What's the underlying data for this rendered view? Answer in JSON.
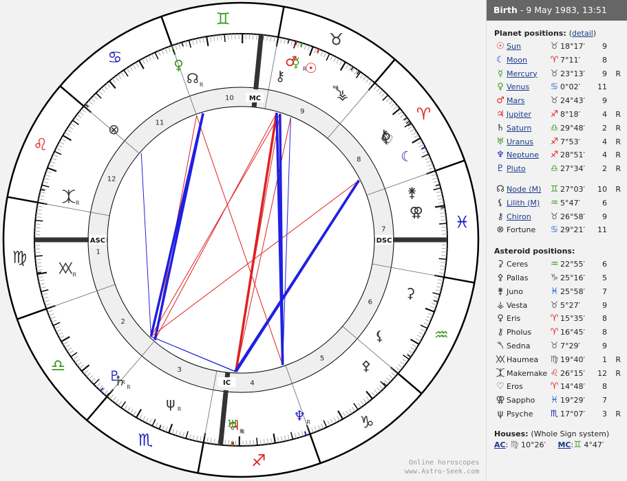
{
  "header": {
    "event": "Birth",
    "datetime": " - 9 May 1983, 13:51"
  },
  "planet_section": {
    "title": "Planet positions:",
    "detail_link": "detail"
  },
  "planets": [
    {
      "name": "Sun",
      "icon": "sun-icon",
      "glyph": "☉",
      "color": "#e02020",
      "sign": "Taurus",
      "sign_glyph": "♉",
      "sign_color": "#666666",
      "degree": "18°17′",
      "house": "9",
      "retro": "",
      "lon": 48.28
    },
    {
      "name": "Moon",
      "icon": "moon-icon",
      "glyph": "☾",
      "color": "#2020c0",
      "sign": "Aries",
      "sign_glyph": "♈",
      "sign_color": "#e02020",
      "degree": "7°11′",
      "house": "8",
      "retro": "",
      "lon": 7.18
    },
    {
      "name": "Mercury",
      "icon": "mercury-icon",
      "glyph": "☿",
      "color": "#3a9a20",
      "sign": "Taurus",
      "sign_glyph": "♉",
      "sign_color": "#666666",
      "degree": "23°13′",
      "house": "9",
      "retro": "R",
      "lon": 53.22
    },
    {
      "name": "Venus",
      "icon": "venus-icon",
      "glyph": "♀",
      "color": "#3a9a20",
      "sign": "Cancer",
      "sign_glyph": "♋",
      "sign_color": "#3a70d0",
      "degree": "0°02′",
      "house": "11",
      "retro": "",
      "lon": 90.03
    },
    {
      "name": "Mars",
      "icon": "mars-icon",
      "glyph": "♂",
      "color": "#e02020",
      "sign": "Taurus",
      "sign_glyph": "♉",
      "sign_color": "#666666",
      "degree": "24°43′",
      "house": "9",
      "retro": "",
      "lon": 54.72
    },
    {
      "name": "Jupiter",
      "icon": "jupiter-icon",
      "glyph": "♃",
      "color": "#e02020",
      "sign": "Sagittarius",
      "sign_glyph": "♐",
      "sign_color": "#e02020",
      "degree": "8°18′",
      "house": "4",
      "retro": "R",
      "lon": 248.3
    },
    {
      "name": "Saturn",
      "icon": "saturn-icon",
      "glyph": "♄",
      "color": "#333333",
      "sign": "Libra",
      "sign_glyph": "♎",
      "sign_color": "#3a9a20",
      "degree": "29°48′",
      "house": "2",
      "retro": "R",
      "lon": 209.8
    },
    {
      "name": "Uranus",
      "icon": "uranus-icon",
      "glyph": "♅",
      "color": "#3a9a20",
      "sign": "Sagittarius",
      "sign_glyph": "♐",
      "sign_color": "#e02020",
      "degree": "7°53′",
      "house": "4",
      "retro": "R",
      "lon": 247.88
    },
    {
      "name": "Neptune",
      "icon": "neptune-icon",
      "glyph": "♆",
      "color": "#2020c0",
      "sign": "Sagittarius",
      "sign_glyph": "♐",
      "sign_color": "#e02020",
      "degree": "28°51′",
      "house": "4",
      "retro": "R",
      "lon": 268.85
    },
    {
      "name": "Pluto",
      "icon": "pluto-icon",
      "glyph": "♇",
      "color": "#2020c0",
      "sign": "Libra",
      "sign_glyph": "♎",
      "sign_color": "#3a9a20",
      "degree": "27°34′",
      "house": "2",
      "retro": "R",
      "lon": 207.57
    }
  ],
  "points": [
    {
      "name": "Node (M)",
      "icon": "north-node-icon",
      "glyph": "☊",
      "color": "#333333",
      "sign": "Gemini",
      "sign_glyph": "♊",
      "sign_color": "#3a9a20",
      "degree": "27°03′",
      "house": "10",
      "retro": "R",
      "link": true,
      "lon": 87.05
    },
    {
      "name": "Lilith (M)",
      "icon": "lilith-icon",
      "glyph": "⚸",
      "color": "#333333",
      "sign": "Aquarius",
      "sign_glyph": "♒",
      "sign_color": "#3a9a20",
      "degree": "5°47′",
      "house": "6",
      "retro": "",
      "link": true,
      "lon": 305.78
    },
    {
      "name": "Chiron",
      "icon": "chiron-icon",
      "glyph": "⚷",
      "color": "#333333",
      "sign": "Taurus",
      "sign_glyph": "♉",
      "sign_color": "#666666",
      "degree": "26°58′",
      "house": "9",
      "retro": "",
      "link": true,
      "lon": 56.97
    },
    {
      "name": "Fortune",
      "icon": "part-of-fortune-icon",
      "glyph": "⊗",
      "color": "#333333",
      "sign": "Cancer",
      "sign_glyph": "♋",
      "sign_color": "#3a70d0",
      "degree": "29°21′",
      "house": "11",
      "retro": "",
      "link": false,
      "lon": 119.35
    }
  ],
  "asteroid_section": {
    "title": "Asteroid positions:"
  },
  "asteroids": [
    {
      "name": "Ceres",
      "icon": "ceres-icon",
      "glyph": "⚳",
      "sign_glyph": "♒",
      "sign_color": "#3a9a20",
      "degree": "22°55′",
      "house": "6",
      "retro": "",
      "lon": 322.92
    },
    {
      "name": "Pallas",
      "icon": "pallas-icon",
      "glyph": "⚴",
      "sign_glyph": "♑",
      "sign_color": "#666666",
      "degree": "25°16′",
      "house": "5",
      "retro": "",
      "lon": 295.27
    },
    {
      "name": "Juno",
      "icon": "juno-icon",
      "glyph": "⚵",
      "sign_glyph": "♓",
      "sign_color": "#2060d0",
      "degree": "25°58′",
      "house": "7",
      "retro": "",
      "lon": 355.97
    },
    {
      "name": "Vesta",
      "icon": "vesta-icon",
      "glyph": "⚶",
      "sign_glyph": "♉",
      "sign_color": "#666666",
      "degree": "5°27′",
      "house": "9",
      "retro": "",
      "lon": 35.45
    },
    {
      "name": "Eris",
      "icon": "eris-icon",
      "glyph": "♀",
      "sign_glyph": "♈",
      "sign_color": "#e02020",
      "degree": "15°35′",
      "house": "8",
      "retro": "",
      "lon": 15.58
    },
    {
      "name": "Pholus",
      "icon": "pholus-icon",
      "glyph": "⚷",
      "sign_glyph": "♈",
      "sign_color": "#e02020",
      "degree": "16°45′",
      "house": "8",
      "retro": "",
      "lon": 16.75
    },
    {
      "name": "Sedna",
      "icon": "sedna-icon",
      "glyph": "⯲",
      "sign_glyph": "♉",
      "sign_color": "#666666",
      "degree": "7°29′",
      "house": "9",
      "retro": "",
      "lon": 37.48
    },
    {
      "name": "Haumea",
      "icon": "haumea-icon",
      "glyph": "⯵",
      "sign_glyph": "♍",
      "sign_color": "#666666",
      "degree": "19°40′",
      "house": "1",
      "retro": "R",
      "lon": 169.67
    },
    {
      "name": "Makemake",
      "icon": "makemake-icon",
      "glyph": "⯰",
      "sign_glyph": "♌",
      "sign_color": "#e02020",
      "degree": "26°15′",
      "house": "12",
      "retro": "R",
      "lon": 146.25
    },
    {
      "name": "Eros",
      "icon": "eros-icon",
      "glyph": "♡",
      "sign_glyph": "♈",
      "sign_color": "#e02020",
      "degree": "14°48′",
      "house": "8",
      "retro": "",
      "lon": 14.8
    },
    {
      "name": "Sappho",
      "icon": "sappho-icon",
      "glyph": "⚢",
      "sign_glyph": "♓",
      "sign_color": "#2060d0",
      "degree": "19°29′",
      "house": "7",
      "retro": "",
      "lon": 349.48
    },
    {
      "name": "Psyche",
      "icon": "psyche-icon",
      "glyph": "ψ",
      "sign_glyph": "♏",
      "sign_color": "#2020c0",
      "degree": "17°07′",
      "house": "3",
      "retro": "R",
      "lon": 227.12
    }
  ],
  "houses": {
    "title": "Houses:",
    "system": "(Whole Sign system)",
    "ac_label": "AC",
    "ac_sign_glyph": "♍",
    "ac_degree": "10°26′",
    "mc_label": "MC",
    "mc_sign_glyph": "♊",
    "mc_degree": "4°47′"
  },
  "wheel": {
    "asc_lon": 160.43,
    "mc_lon": 64.78,
    "asc_label": "ASC",
    "dsc_label": "DSC",
    "mc_label": "MC",
    "ic_label": "IC",
    "signs": [
      {
        "name": "Aries",
        "glyph": "♈",
        "color": "#e02020"
      },
      {
        "name": "Taurus",
        "glyph": "♉",
        "color": "#333333"
      },
      {
        "name": "Gemini",
        "glyph": "♊",
        "color": "#3a9a20"
      },
      {
        "name": "Cancer",
        "glyph": "♋",
        "color": "#2020c0"
      },
      {
        "name": "Leo",
        "glyph": "♌",
        "color": "#e02020"
      },
      {
        "name": "Virgo",
        "glyph": "♍",
        "color": "#333333"
      },
      {
        "name": "Libra",
        "glyph": "♎",
        "color": "#3a9a20"
      },
      {
        "name": "Scorpio",
        "glyph": "♏",
        "color": "#2020c0"
      },
      {
        "name": "Sagittarius",
        "glyph": "♐",
        "color": "#e02020"
      },
      {
        "name": "Capricorn",
        "glyph": "♑",
        "color": "#333333"
      },
      {
        "name": "Aquarius",
        "glyph": "♒",
        "color": "#3a9a20"
      },
      {
        "name": "Pisces",
        "glyph": "♓",
        "color": "#2020c0"
      }
    ],
    "house_numbers": [
      "1",
      "2",
      "3",
      "4",
      "5",
      "6",
      "7",
      "8",
      "9",
      "10",
      "11",
      "12"
    ],
    "aspects": [
      {
        "a": "Mars",
        "b": "Jupiter",
        "type": "opposition",
        "color": "#e02020",
        "strong": true
      },
      {
        "a": "Mercury",
        "b": "Uranus",
        "type": "opposition",
        "color": "#e02020",
        "strong": false
      },
      {
        "a": "Sun",
        "b": "Jupiter",
        "type": "opposition",
        "color": "#e02020",
        "strong": false
      },
      {
        "a": "Mercury",
        "b": "Pluto",
        "type": "square",
        "color": "#e02020",
        "strong": false
      },
      {
        "a": "Mars",
        "b": "Saturn",
        "type": "square",
        "color": "#e02020",
        "strong": false
      },
      {
        "a": "Venus",
        "b": "Saturn",
        "type": "square",
        "color": "#e02020",
        "strong": false
      },
      {
        "a": "Venus",
        "b": "Neptune",
        "type": "trine",
        "color": "#e02020",
        "strong": false
      },
      {
        "a": "Saturn",
        "b": "Node",
        "type": "trine",
        "color": "#2020e0",
        "strong": true
      },
      {
        "a": "Pluto",
        "b": "Node",
        "type": "trine",
        "color": "#2020e0",
        "strong": true
      },
      {
        "a": "Sun",
        "b": "Neptune",
        "type": "quincunx",
        "color": "#2020e0",
        "strong": false
      },
      {
        "a": "Moon",
        "b": "Pluto",
        "type": "opposition",
        "color": "#e02020",
        "strong": false
      },
      {
        "a": "Moon",
        "b": "Jupiter",
        "type": "trine",
        "color": "#2020e0",
        "strong": true
      },
      {
        "a": "Moon",
        "b": "Uranus",
        "type": "trine",
        "color": "#2020e0",
        "strong": true
      },
      {
        "a": "Mercury",
        "b": "Neptune",
        "type": "quincunx",
        "color": "#2020e0",
        "strong": true
      },
      {
        "a": "Mars",
        "b": "Neptune",
        "type": "quincunx",
        "color": "#2020e0",
        "strong": true
      },
      {
        "a": "Uranus",
        "b": "Pluto",
        "type": "sextile",
        "color": "#2020e0",
        "strong": false
      },
      {
        "a": "Jupiter",
        "b": "Pluto",
        "type": "sextile",
        "color": "#2020e0",
        "strong": false
      },
      {
        "a": "Pluto",
        "b": "Fortune",
        "type": "square",
        "color": "#2020e0",
        "strong": false
      }
    ]
  },
  "watermark": {
    "line1": "Online horoscopes",
    "line2": "www.Astro-Seek.com"
  }
}
